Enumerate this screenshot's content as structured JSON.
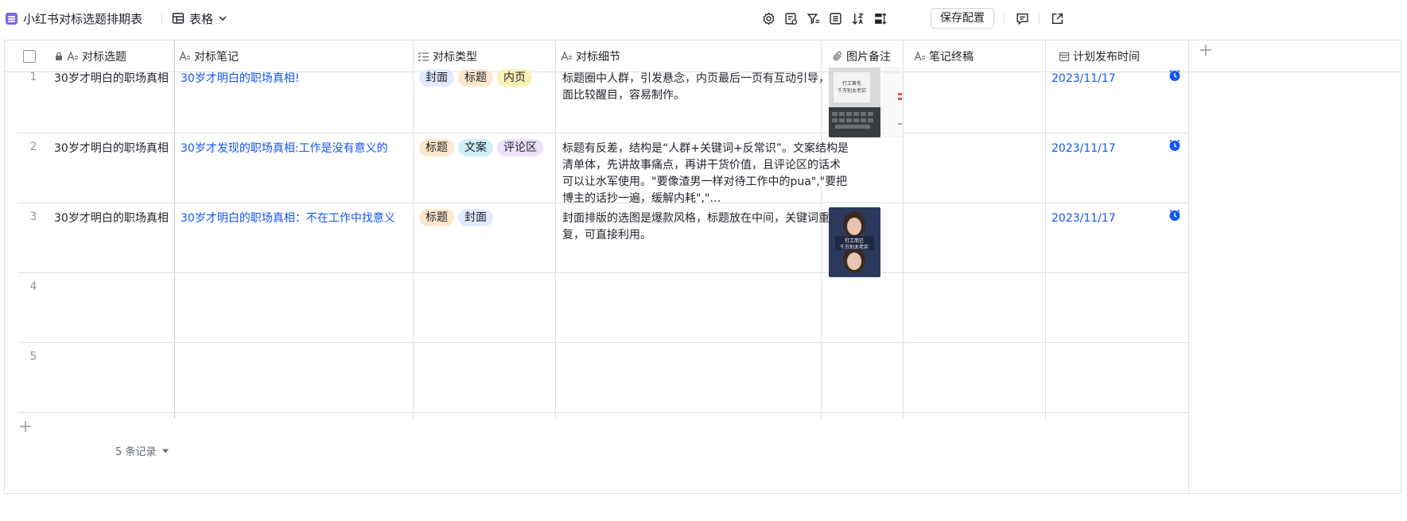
{
  "toolbar": {
    "app_title": "小红书对标选题排期表",
    "view_label": "表格",
    "save_label": "保存配置",
    "icons": [
      "settings-icon",
      "field-config-icon",
      "filter-icon",
      "group-icon",
      "sort-icon",
      "row-height-icon"
    ]
  },
  "columns": [
    {
      "label": "对标选题",
      "type": "text",
      "locked": true
    },
    {
      "label": "对标笔记",
      "type": "text"
    },
    {
      "label": "对标类型",
      "type": "multi-select"
    },
    {
      "label": "对标细节",
      "type": "text"
    },
    {
      "label": "图片备注",
      "type": "attachment"
    },
    {
      "label": "笔记终稿",
      "type": "text"
    },
    {
      "label": "计划发布时间",
      "type": "date"
    }
  ],
  "rows": [
    {
      "num": "1",
      "topic": "30岁才明白的职场真相",
      "note": "30岁才明白的职场真相!",
      "tags": [
        {
          "label": "封面",
          "color": "#e1eaff"
        },
        {
          "label": "标题",
          "color": "#fee7cd"
        },
        {
          "label": "内页",
          "color": "#fbf0b4"
        }
      ],
      "detail": "标题圈中人群，引发悬念，内页最后一页有互动引导，封面比较醒目，容易制作。",
      "date": "2023/11/17"
    },
    {
      "num": "2",
      "topic": "30岁才明白的职场真相",
      "note": "30岁才发现的职场真相:工作是没有意义的",
      "tags": [
        {
          "label": "标题",
          "color": "#fee7cd"
        },
        {
          "label": "文案",
          "color": "#cdf0f7"
        },
        {
          "label": "评论区",
          "color": "#ece2fe"
        }
      ],
      "detail": "标题有反差，结构是“人群+关键词+反常识”。文案结构是清单体，先讲故事痛点，再讲干货价值，且评论区的话术可以让水军使用。\"要像渣男一样对待工作中的pua\",\"要把博主的话抄一遍，缓解内耗\",\"…",
      "date": "2023/11/17"
    },
    {
      "num": "3",
      "topic": "30岁才明白的职场真相",
      "note": "30岁才明白的职场真相：不在工作中找意义",
      "tags": [
        {
          "label": "标题",
          "color": "#fee7cd"
        },
        {
          "label": "封面",
          "color": "#e1eaff"
        }
      ],
      "detail": "封面排版的选图是爆款风格，标题放在中间，关键词重复，可直接利用。",
      "date": "2023/11/17"
    },
    {
      "num": "4"
    },
    {
      "num": "5"
    }
  ],
  "images": {
    "row1_a_text": "打工首先 千万别太老实",
    "row3_a_text": "打工而已 千万别太老实"
  },
  "footer": {
    "count_label": "5 条记录"
  },
  "colors": {
    "link": "#1456f0",
    "border": "#dee0e3",
    "app_icon": "#7b67ee"
  }
}
